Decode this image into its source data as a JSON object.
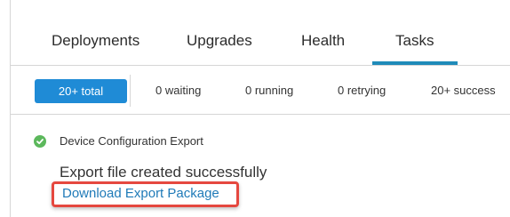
{
  "tabs": [
    {
      "label": "Deployments"
    },
    {
      "label": "Upgrades"
    },
    {
      "label": "Health"
    },
    {
      "label": "Tasks",
      "active": true
    }
  ],
  "filters": {
    "total": "20+ total",
    "waiting": "0 waiting",
    "running": "0 running",
    "retrying": "0 retrying",
    "success": "20+ success"
  },
  "task": {
    "status_icon": "check-circle-icon",
    "title": "Device Configuration Export",
    "message": "Export file created successfully",
    "link": "Download Export Package"
  },
  "colors": {
    "accent": "#1f8bd6",
    "tab_underline": "#1f8bb9",
    "success": "#5cb85c",
    "highlight": "#e5483f",
    "link": "#1f7ab8"
  }
}
